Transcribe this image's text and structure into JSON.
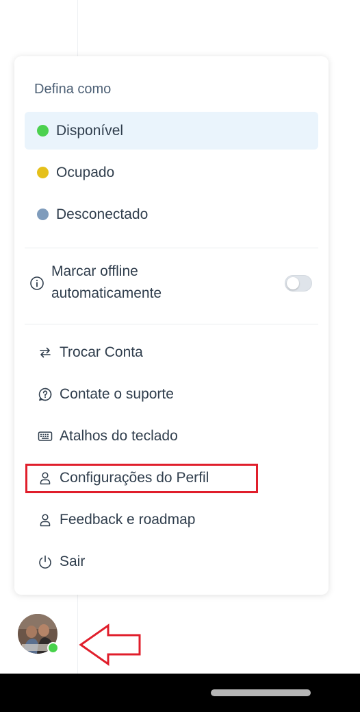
{
  "menu": {
    "heading": "Defina como",
    "status_options": [
      {
        "label": "Disponível",
        "color": "#4cd14f",
        "selected": true
      },
      {
        "label": "Ocupado",
        "color": "#e5c01b",
        "selected": false
      },
      {
        "label": "Desconectado",
        "color": "#7f9cbc",
        "selected": false
      }
    ],
    "auto_offline": {
      "label": "Marcar offline automaticamente",
      "enabled": false
    },
    "actions": [
      {
        "label": "Trocar Conta",
        "icon": "swap-icon"
      },
      {
        "label": "Contate o suporte",
        "icon": "help-circle-icon"
      },
      {
        "label": "Atalhos do teclado",
        "icon": "keyboard-icon"
      },
      {
        "label": "Configurações do Perfil",
        "icon": "user-icon"
      },
      {
        "label": "Feedback e roadmap",
        "icon": "user-icon"
      },
      {
        "label": "Sair",
        "icon": "power-icon"
      }
    ]
  },
  "user": {
    "avatar": "user-avatar",
    "presence_color": "#48d24b"
  },
  "annotations": {
    "highlight_color": "#e01e2b"
  }
}
